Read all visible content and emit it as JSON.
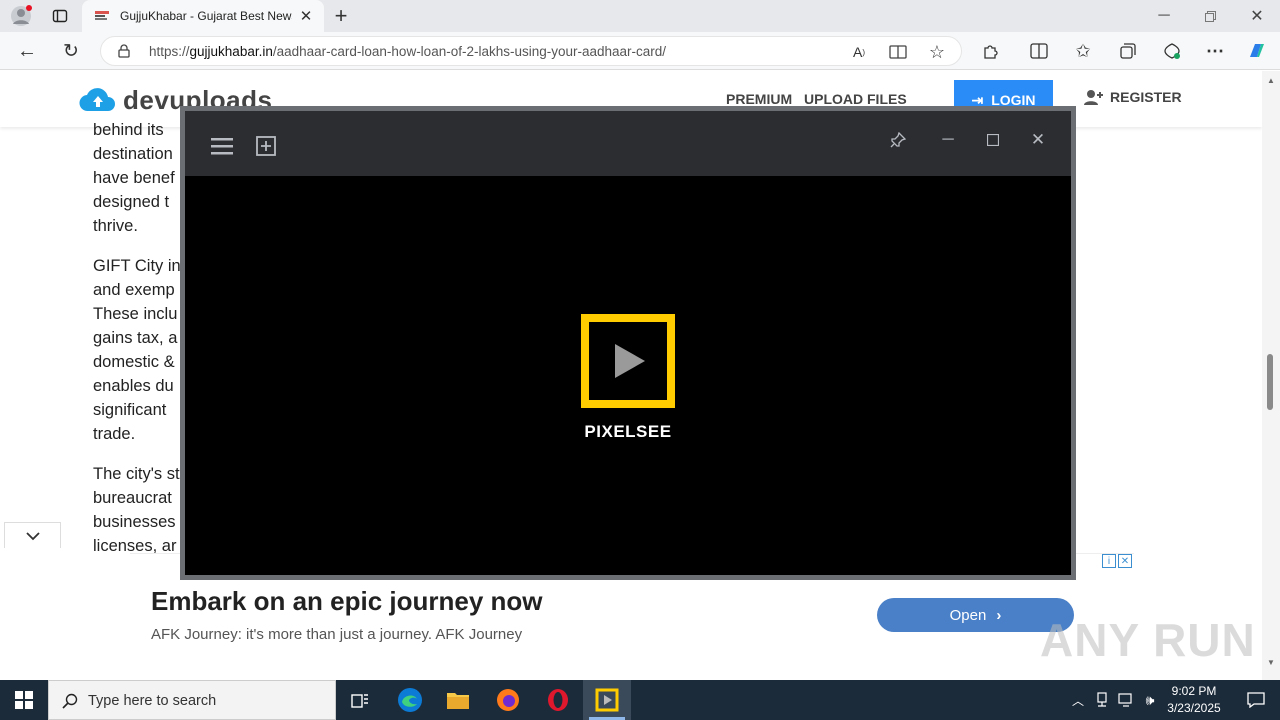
{
  "browser": {
    "tab_title": "GujjuKhabar - Gujarat Best News",
    "url_prefix": "https://",
    "url_host": "gujjukhabar.in",
    "url_path": "/aadhaar-card-loan-how-loan-of-2-lakhs-using-your-aadhaar-card/"
  },
  "site": {
    "logo": "devuploads",
    "nav": {
      "premium": "PREMIUM",
      "upload": "UPLOAD FILES",
      "login": "LOGIN",
      "register": "REGISTER"
    }
  },
  "article": {
    "lines_p1": [
      "behind its",
      "destination",
      "have benef",
      "designed t",
      "thrive."
    ],
    "lines_p2": [
      "GIFT City in",
      "and exemp",
      "These inclu",
      "gains tax, a",
      "domestic &",
      "enables du",
      "significant",
      "trade."
    ],
    "lines_p3": [
      "The city's st",
      "bureaucrat",
      "businesses",
      "licenses, ar"
    ]
  },
  "ad": {
    "headline": "Embark on an epic journey now",
    "description": "AFK Journey: it's more than just a journey. AFK Journey",
    "button": "Open"
  },
  "player": {
    "brand": "PIXELSEE"
  },
  "watermark": "ANY RUN",
  "taskbar": {
    "search_placeholder": "Type here to search",
    "time": "9:02 PM",
    "date": "3/23/2025"
  },
  "colors": {
    "accent_login": "#2a8cf6",
    "player_logo": "#ffcc00",
    "ad_button": "#4a80c7",
    "taskbar": "#1c2b3a"
  }
}
